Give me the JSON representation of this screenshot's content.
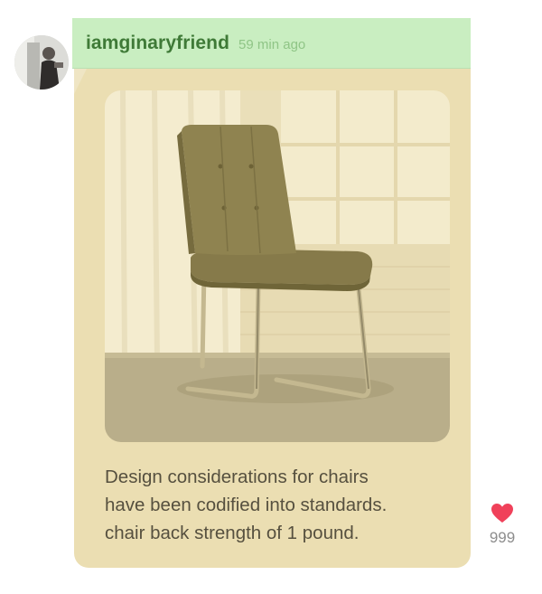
{
  "post": {
    "username": "iamginaryfriend",
    "timestamp": "59 min ago",
    "avatar_icon": "user-avatar-photo",
    "image_icon": "chair-photo",
    "caption_lines": [
      "Design considerations for chairs",
      "have been codified into standards.",
      "chair back strength of 1 pound."
    ],
    "likes": {
      "icon": "heart-icon",
      "count": "999",
      "color": "#f0415a"
    }
  },
  "colors": {
    "header_bg": "#c9eec1",
    "username": "#3f7a37",
    "timestamp": "#8fc586",
    "bubble_bg": "#ebdeb2",
    "caption": "#56503f"
  }
}
